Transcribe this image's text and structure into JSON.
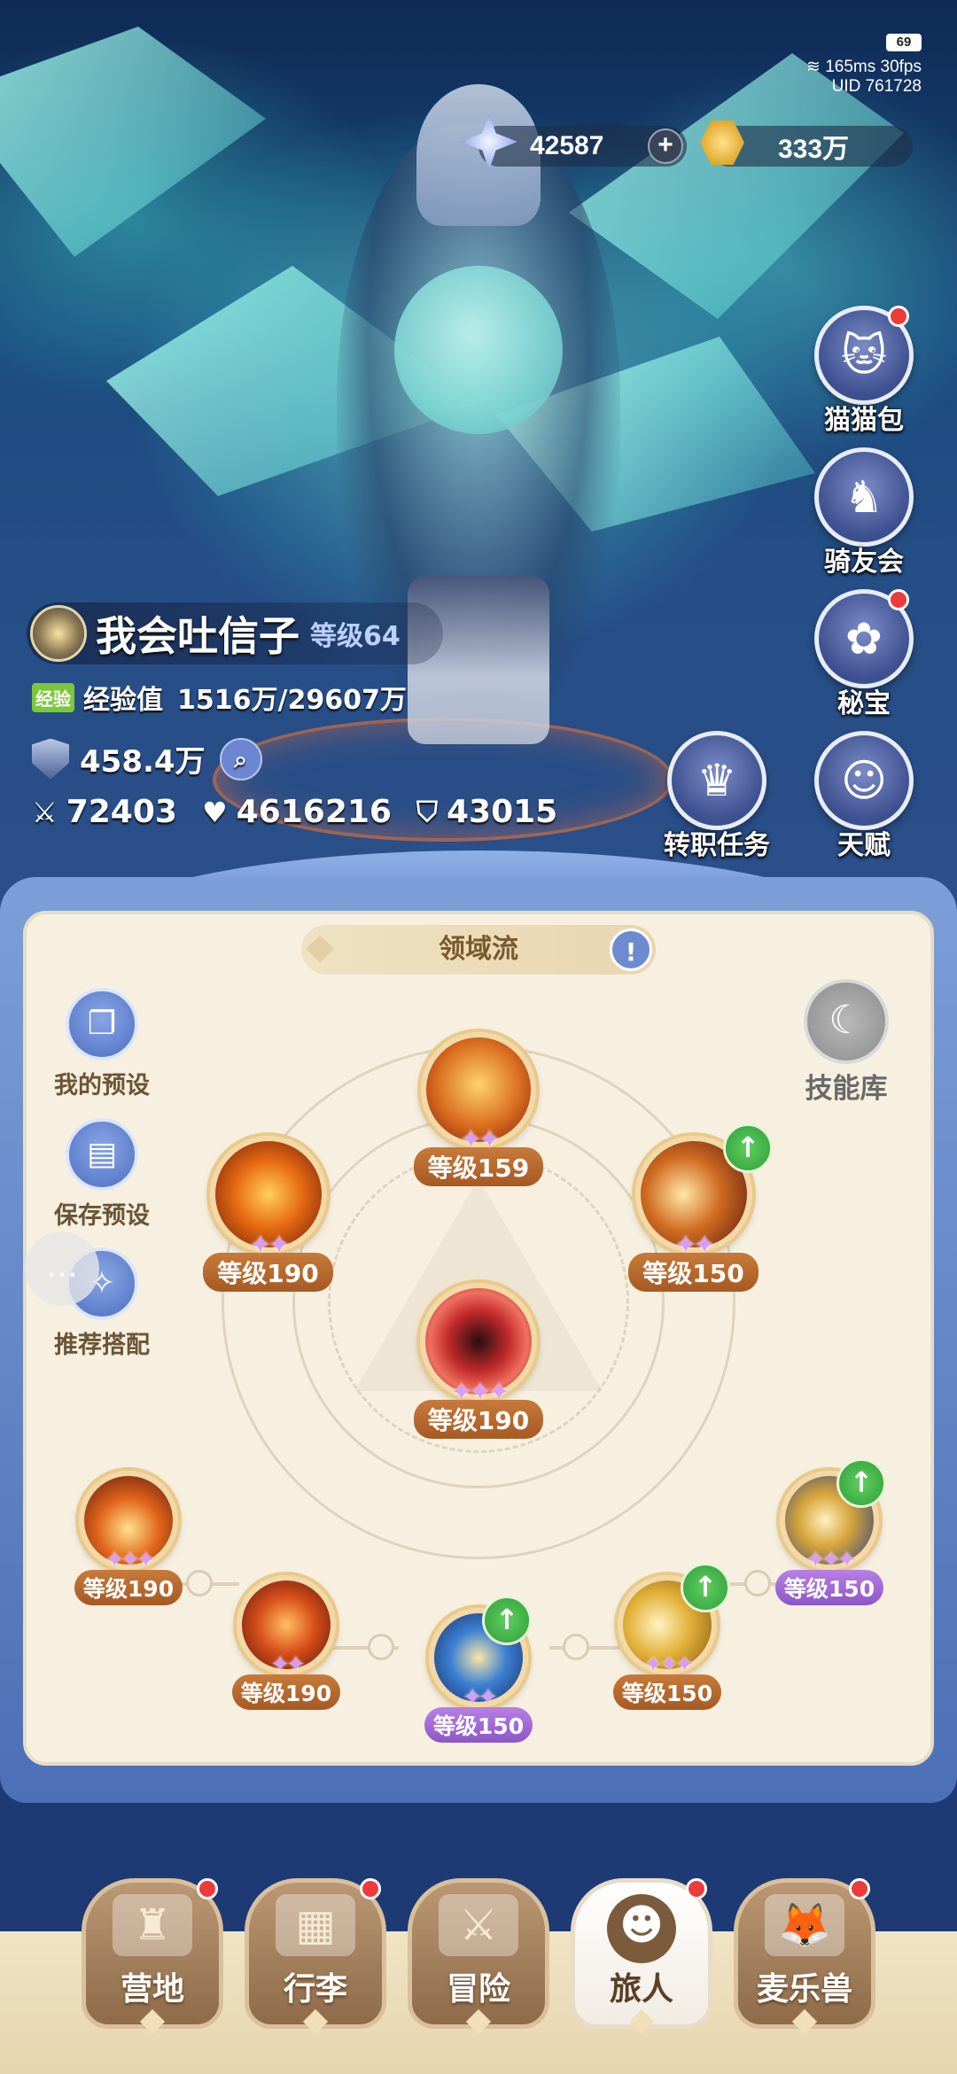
{
  "status": {
    "battery": "69",
    "ping": "165ms",
    "fps": "30fps",
    "uid": "UID 761728"
  },
  "currency": {
    "gems": "42587",
    "gold": "333万"
  },
  "side_menu": [
    {
      "label": "猫猫包",
      "icon": "cat-bag-icon",
      "badge": true
    },
    {
      "label": "骑友会",
      "icon": "horse-icon",
      "badge": false
    },
    {
      "label": "秘宝",
      "icon": "treasure-icon",
      "badge": true
    },
    {
      "label": "转职任务",
      "icon": "crown-icon",
      "badge": false
    },
    {
      "label": "天赋",
      "icon": "talent-head-icon",
      "badge": false
    }
  ],
  "player": {
    "name": "我会吐信子",
    "level": "等级64",
    "exp_tag": "经验",
    "exp_label": "经验值",
    "exp_value": "1516万/29607万",
    "power": "458.4万",
    "attack": "72403",
    "hp": "4616216",
    "defense": "43015"
  },
  "panel": {
    "build_name": "领域流",
    "tools": [
      {
        "label": "我的预设",
        "icon": "cards-icon"
      },
      {
        "label": "保存预设",
        "icon": "save-icon"
      },
      {
        "label": "推荐搭配",
        "icon": "recommend-icon"
      }
    ],
    "skill_lib": "技能库",
    "skills": [
      {
        "id": "top",
        "level": "等级159",
        "stars": "✦✦",
        "color": "orange",
        "upgrade": false
      },
      {
        "id": "upper-left",
        "level": "等级190",
        "stars": "✦✦",
        "color": "orange",
        "upgrade": false
      },
      {
        "id": "upper-right",
        "level": "等级150",
        "stars": "✦✦",
        "color": "orange",
        "upgrade": true
      },
      {
        "id": "center",
        "level": "等级190",
        "stars": "✦✦✦",
        "color": "orange",
        "upgrade": false
      },
      {
        "id": "low-left-1",
        "level": "等级190",
        "stars": "✦✦✦",
        "color": "orange",
        "upgrade": false
      },
      {
        "id": "low-left-2",
        "level": "等级190",
        "stars": "✦✦",
        "color": "orange",
        "upgrade": false
      },
      {
        "id": "low-center",
        "level": "等级150",
        "stars": "✦✦",
        "color": "purple",
        "upgrade": true
      },
      {
        "id": "low-right-2",
        "level": "等级150",
        "stars": "✦✦✦",
        "color": "orange",
        "upgrade": true
      },
      {
        "id": "low-right-1",
        "level": "等级150",
        "stars": "✦✦✦",
        "color": "purple",
        "upgrade": true
      }
    ]
  },
  "bottom_nav": [
    {
      "label": "营地",
      "icon": "castle-icon",
      "badge": true,
      "active": false
    },
    {
      "label": "行李",
      "icon": "backpack-icon",
      "badge": true,
      "active": false
    },
    {
      "label": "冒险",
      "icon": "swords-icon",
      "badge": false,
      "active": false
    },
    {
      "label": "旅人",
      "icon": "traveler-icon",
      "badge": true,
      "active": true
    },
    {
      "label": "麦乐兽",
      "icon": "fox-icon",
      "badge": true,
      "active": false
    }
  ],
  "colors": {
    "panel_bg": "#f7f0e1",
    "accent_blue": "#6e8ad0",
    "level_orange": "#a65a23",
    "level_purple": "#8c56c6",
    "upgrade_green": "#2e9e3a",
    "badge_red": "#ec3b3b"
  }
}
